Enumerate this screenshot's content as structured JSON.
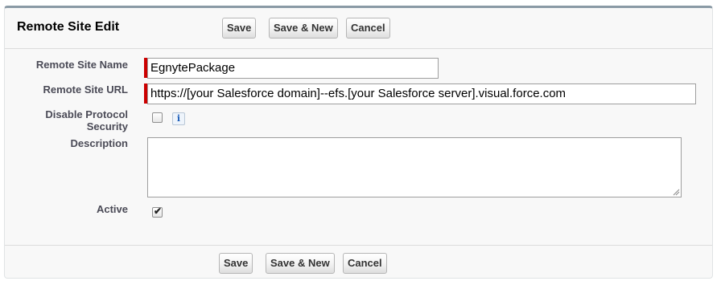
{
  "page": {
    "title": "Remote Site Edit"
  },
  "buttons": {
    "save": "Save",
    "save_new": "Save & New",
    "cancel": "Cancel"
  },
  "form": {
    "remote_site_name": {
      "label": "Remote Site Name",
      "value": "EgnytePackage",
      "required": true
    },
    "remote_site_url": {
      "label": "Remote Site URL",
      "value": "https://[your Salesforce domain]--efs.[your Salesforce server].visual.force.com",
      "required": true
    },
    "disable_protocol_security": {
      "label_line1": "Disable Protocol",
      "label_line2": "Security",
      "checked": false,
      "help_icon": "info-icon",
      "help_glyph": "i"
    },
    "description": {
      "label": "Description",
      "value": ""
    },
    "active": {
      "label": "Active",
      "checked": true
    }
  },
  "colors": {
    "required_bar": "#cc0000",
    "header_border": "#8a9aa5",
    "label_text": "#4a4a56"
  }
}
